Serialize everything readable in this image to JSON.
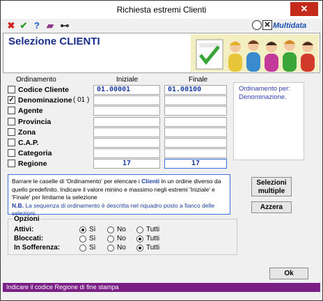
{
  "window": {
    "title": "Richiesta estremi Clienti",
    "close_glyph": "✕"
  },
  "toolbar": {
    "icons": [
      {
        "name": "cancel-icon",
        "glyph": "✖",
        "color": "#d02020"
      },
      {
        "name": "confirm-icon",
        "glyph": "✔",
        "color": "#2a9a2a"
      },
      {
        "name": "help-icon",
        "glyph": "?",
        "color": "#1a5fd0"
      },
      {
        "name": "book-icon",
        "glyph": "▰",
        "color": "#8a3a8a"
      },
      {
        "name": "binoculars-icon",
        "glyph": "⊷",
        "color": "#222222"
      }
    ],
    "brand": "Multidata",
    "brand_box": "✕"
  },
  "header": {
    "title": "Selezione CLIENTI"
  },
  "columns": {
    "ordinamento": "Ordinamento",
    "iniziale": "Iniziale",
    "finale": "Finale"
  },
  "rows": [
    {
      "label": "Codice Cliente",
      "checked": false,
      "order": "",
      "initial": "01.00001",
      "final": "01.00100"
    },
    {
      "label": "Denominazione",
      "checked": true,
      "order": "( 01 )",
      "initial": "",
      "final": ""
    },
    {
      "label": "Agente",
      "checked": false,
      "order": "",
      "initial": "",
      "final": ""
    },
    {
      "label": "Provincia",
      "checked": false,
      "order": "",
      "initial": "",
      "final": ""
    },
    {
      "label": "Zona",
      "checked": false,
      "order": "",
      "initial": "",
      "final": ""
    },
    {
      "label": "C.A.P.",
      "checked": false,
      "order": "",
      "initial": "",
      "final": ""
    },
    {
      "label": "Categoria",
      "checked": false,
      "order": "",
      "initial": "",
      "final": ""
    },
    {
      "label": "Regione",
      "checked": false,
      "order": "",
      "initial": "17",
      "final": "17"
    }
  ],
  "side_info": "Ordinamento per: Denominazione.",
  "note": {
    "part1": "Barrare le caselle di 'Ordinamento' per elencare i",
    "highlight": "Clienti",
    "part2": "in un ordine diverso da quello predefinito. Indicare il valore minino e massimo negli estremi 'Iniziale' e 'Finale' per limitarne la selezione",
    "nb": "N.B.",
    "nb_text": "La sequenza di ordinamento è descritta nel riquadro posto a fianco delle selezioni."
  },
  "buttons": {
    "selezioni": "Selezioni multiple",
    "azzera": "Azzera",
    "ok": "Ok"
  },
  "options": {
    "title": "Opzioni",
    "choices": [
      "Sì",
      "No",
      "Tutti"
    ],
    "rows": [
      {
        "label": "Attivi:",
        "selected": 0
      },
      {
        "label": "Bloccati:",
        "selected": 2
      },
      {
        "label": "In Sofferenza:",
        "selected": 2
      }
    ]
  },
  "status": "Indicare il codice Regione di fine stampa"
}
